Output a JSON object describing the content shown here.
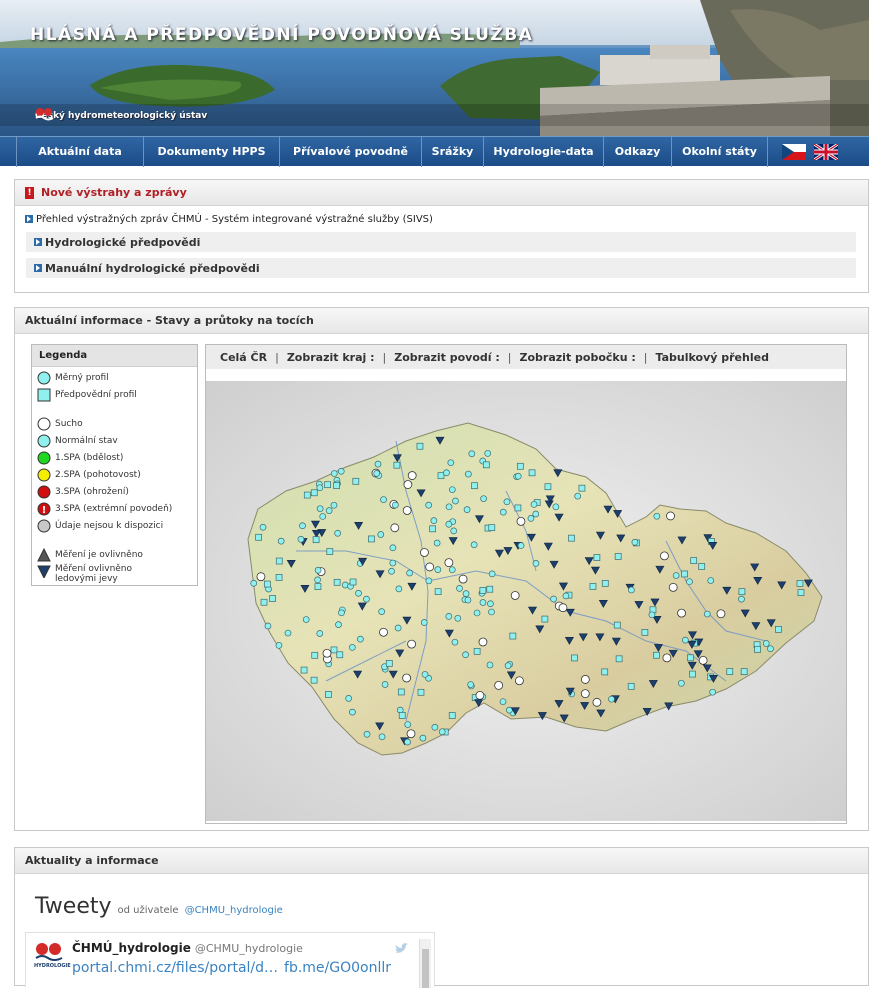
{
  "header": {
    "title": "HLÁSNÁ A PŘEDPOVĚDNÍ POVODŇOVÁ SLUŽBA",
    "institution": "Český hydrometeorologický ústav"
  },
  "nav": {
    "items": [
      "Aktuální data",
      "Dokumenty HPPS",
      "Přívalové povodně",
      "Srážky",
      "Hydrologie-data",
      "Odkazy",
      "Okolní státy"
    ]
  },
  "warnings": {
    "title": "Nové výstrahy a zprávy",
    "link": "Přehled výstražných zpráv ČHMÚ - Systém integrované výstražné služby (SIVS)",
    "sections": [
      "Hydrologické předpovědi",
      "Manuální hydrologické předpovědi"
    ]
  },
  "current": {
    "title": "Aktuální informace - Stavy a průtoky na tocích",
    "legend": {
      "title": "Legenda",
      "items": [
        "Měrný profil",
        "Předpovědní profil",
        "Sucho",
        "Normální stav",
        "1.SPA (bdělost)",
        "2.SPA (pohotovost)",
        "3.SPA (ohrožení)",
        "3.SPA (extrémní povodeň)",
        "Údaje nejsou k dispozici",
        "Měření je ovlivněno",
        "Měření ovlivněno",
        "ledovými jevy"
      ]
    },
    "map_tabs": [
      "Celá ČR",
      "Zobrazit kraj :",
      "Zobrazit povodí :",
      "Zobrazit pobočku :",
      "Tabulkový přehled"
    ],
    "colors": {
      "normal": "#8ff0ee",
      "drought": "#ffffff",
      "spa1": "#1fd81f",
      "spa2": "#f4ef00",
      "spa3": "#d10f0f",
      "ice": "#1d3f6b",
      "na": "#c8c8c8"
    }
  },
  "news": {
    "title": "Aktuality a informace",
    "widget_title": "Tweety",
    "by_label": "od uživatele",
    "handle": "@CHMU_hydrologie",
    "tweet": {
      "author": "ČHMÚ_hydrologie",
      "handle": "@CHMU_hydrologie",
      "logo_text": "HYDROLOGIE",
      "link1": "portal.chmi.cz/files/portal/d…",
      "link2": "fb.me/GO0onllr"
    }
  }
}
